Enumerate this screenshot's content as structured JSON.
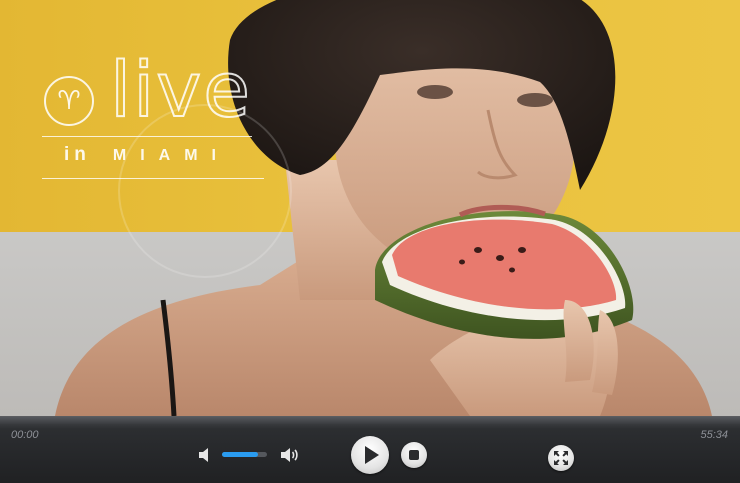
{
  "video": {
    "logo": {
      "wordmark": "live",
      "emblem_glyph": "♈",
      "tagline_in": "in",
      "tagline_city": "MIAMI"
    },
    "colors": {
      "wall": "#e9c13c",
      "floor": "#c4c3c1"
    }
  },
  "controls": {
    "time_current": "00:00",
    "time_total": "55:34",
    "volume_level": 0.8,
    "icons": {
      "volume_min": "volume-low-icon",
      "volume_max": "volume-high-icon",
      "play": "play-icon",
      "stop": "stop-icon",
      "fullscreen": "fullscreen-icon"
    },
    "colors": {
      "volume_fill": "#2a9cf0",
      "bar": "#202123"
    }
  }
}
